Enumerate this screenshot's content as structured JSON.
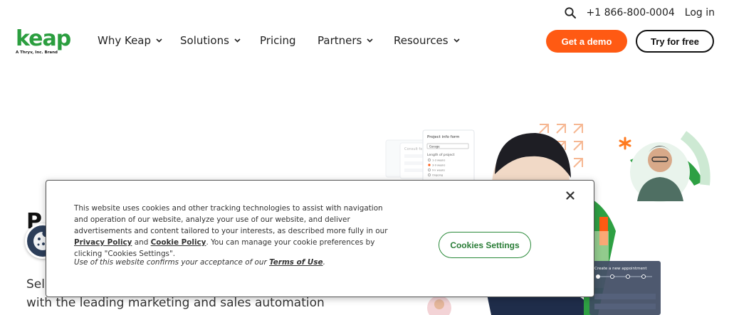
{
  "utility": {
    "phone": "+1 866-800-0004",
    "login": "Log in"
  },
  "logo": {
    "word": "keap",
    "tagline": "A Thryv, Inc. Brand"
  },
  "nav": {
    "items": [
      {
        "label": "Why Keap",
        "has_dropdown": true
      },
      {
        "label": "Solutions",
        "has_dropdown": true
      },
      {
        "label": "Pricing",
        "has_dropdown": false
      },
      {
        "label": "Partners",
        "has_dropdown": true
      },
      {
        "label": "Resources",
        "has_dropdown": true
      }
    ]
  },
  "cta": {
    "demo": "Get a demo",
    "try": "Try for free"
  },
  "hero": {
    "title_fragment": "P",
    "subtitle_line1": "Sell",
    "subtitle_line2": "with the leading marketing and sales automation"
  },
  "hero_art": {
    "form_title": "Project info form",
    "form_select": "Garage",
    "form_length": "Length of project",
    "form_opts": [
      "1-3 weeks",
      "3-9 weeks",
      "9 k weeks",
      "Ongoing"
    ],
    "consult_label": "Consult fo",
    "appointment_title": "Create a new appointment"
  },
  "cookie_banner": {
    "body_part1": "This website uses cookies and other tracking technologies to assist with navigation and operation of our website, analyze your use of our website, and deliver advertisements and content tailored to your interests, as described more fully in our ",
    "privacy_link": "Privacy Policy",
    "and": " and ",
    "cookie_link": "Cookie Policy",
    "body_part2": ". You can manage your cookie preferences by clicking \"Cookies Settings\".",
    "usage_text": "Use of this website confirms your acceptance of our ",
    "terms_link": "Terms of Use",
    "usage_end": ".",
    "settings_button": "Cookies Settings"
  },
  "colors": {
    "brand_green": "#2b9e3f",
    "demo_orange": "#ff5a13",
    "settings_green": "#2a7d37",
    "cookie_fab": "#2c3e5a"
  },
  "icons": {
    "search": "search-icon",
    "chevron": "chevron-down-icon",
    "close": "close-icon",
    "cookie": "cookie-icon"
  }
}
